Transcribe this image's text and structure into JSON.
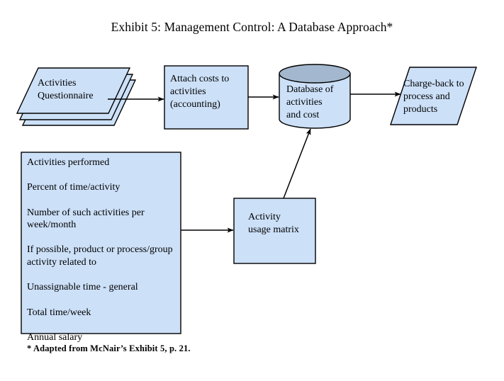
{
  "title": "Exhibit 5: Management Control: A Database Approach*",
  "colors": {
    "shape_fill": "#cce0f8",
    "cylinder_top_fill": "#a3b8ce",
    "stroke": "#000000",
    "background": "#ffffff"
  },
  "nodes": {
    "questionnaire_stack": {
      "label": "Activities\nQuestionnaire",
      "shape": "stacked-documents"
    },
    "attach_costs": {
      "label": "Attach costs to\nactivities\n(accounting)",
      "shape": "rectangle"
    },
    "database": {
      "label": "Database of\nactivities\nand cost",
      "shape": "cylinder"
    },
    "charge_back": {
      "label": "Charge-back to\nprocess and\nproducts",
      "shape": "parallelogram"
    },
    "activity_usage_matrix": {
      "label": "Activity\nusage matrix",
      "shape": "rectangle"
    },
    "questionnaire_contents": {
      "shape": "rectangle",
      "items": [
        "Activities performed",
        "Percent of time/activity",
        "Number of such activities per\nweek/month",
        "If possible, product or\nprocess/group activity related to",
        "Unassignable time - general",
        "Total time/week",
        "Annual salary"
      ]
    }
  },
  "connectors": [
    {
      "name": "stack-to-attach-costs",
      "from": "questionnaire_stack",
      "to": "attach_costs",
      "style": "arrow"
    },
    {
      "name": "attach-costs-to-database",
      "from": "attach_costs",
      "to": "database",
      "style": "arrow"
    },
    {
      "name": "database-to-charge-back",
      "from": "database",
      "to": "charge_back",
      "style": "arrow"
    },
    {
      "name": "questionnaire-contents-to-matrix",
      "from": "questionnaire_contents",
      "to": "activity_usage_matrix",
      "style": "arrow"
    },
    {
      "name": "matrix-to-database",
      "from": "activity_usage_matrix",
      "to": "database",
      "style": "arrow-diagonal"
    }
  ],
  "footnote": "* Adapted from McNair’s Exhibit 5, p. 21."
}
